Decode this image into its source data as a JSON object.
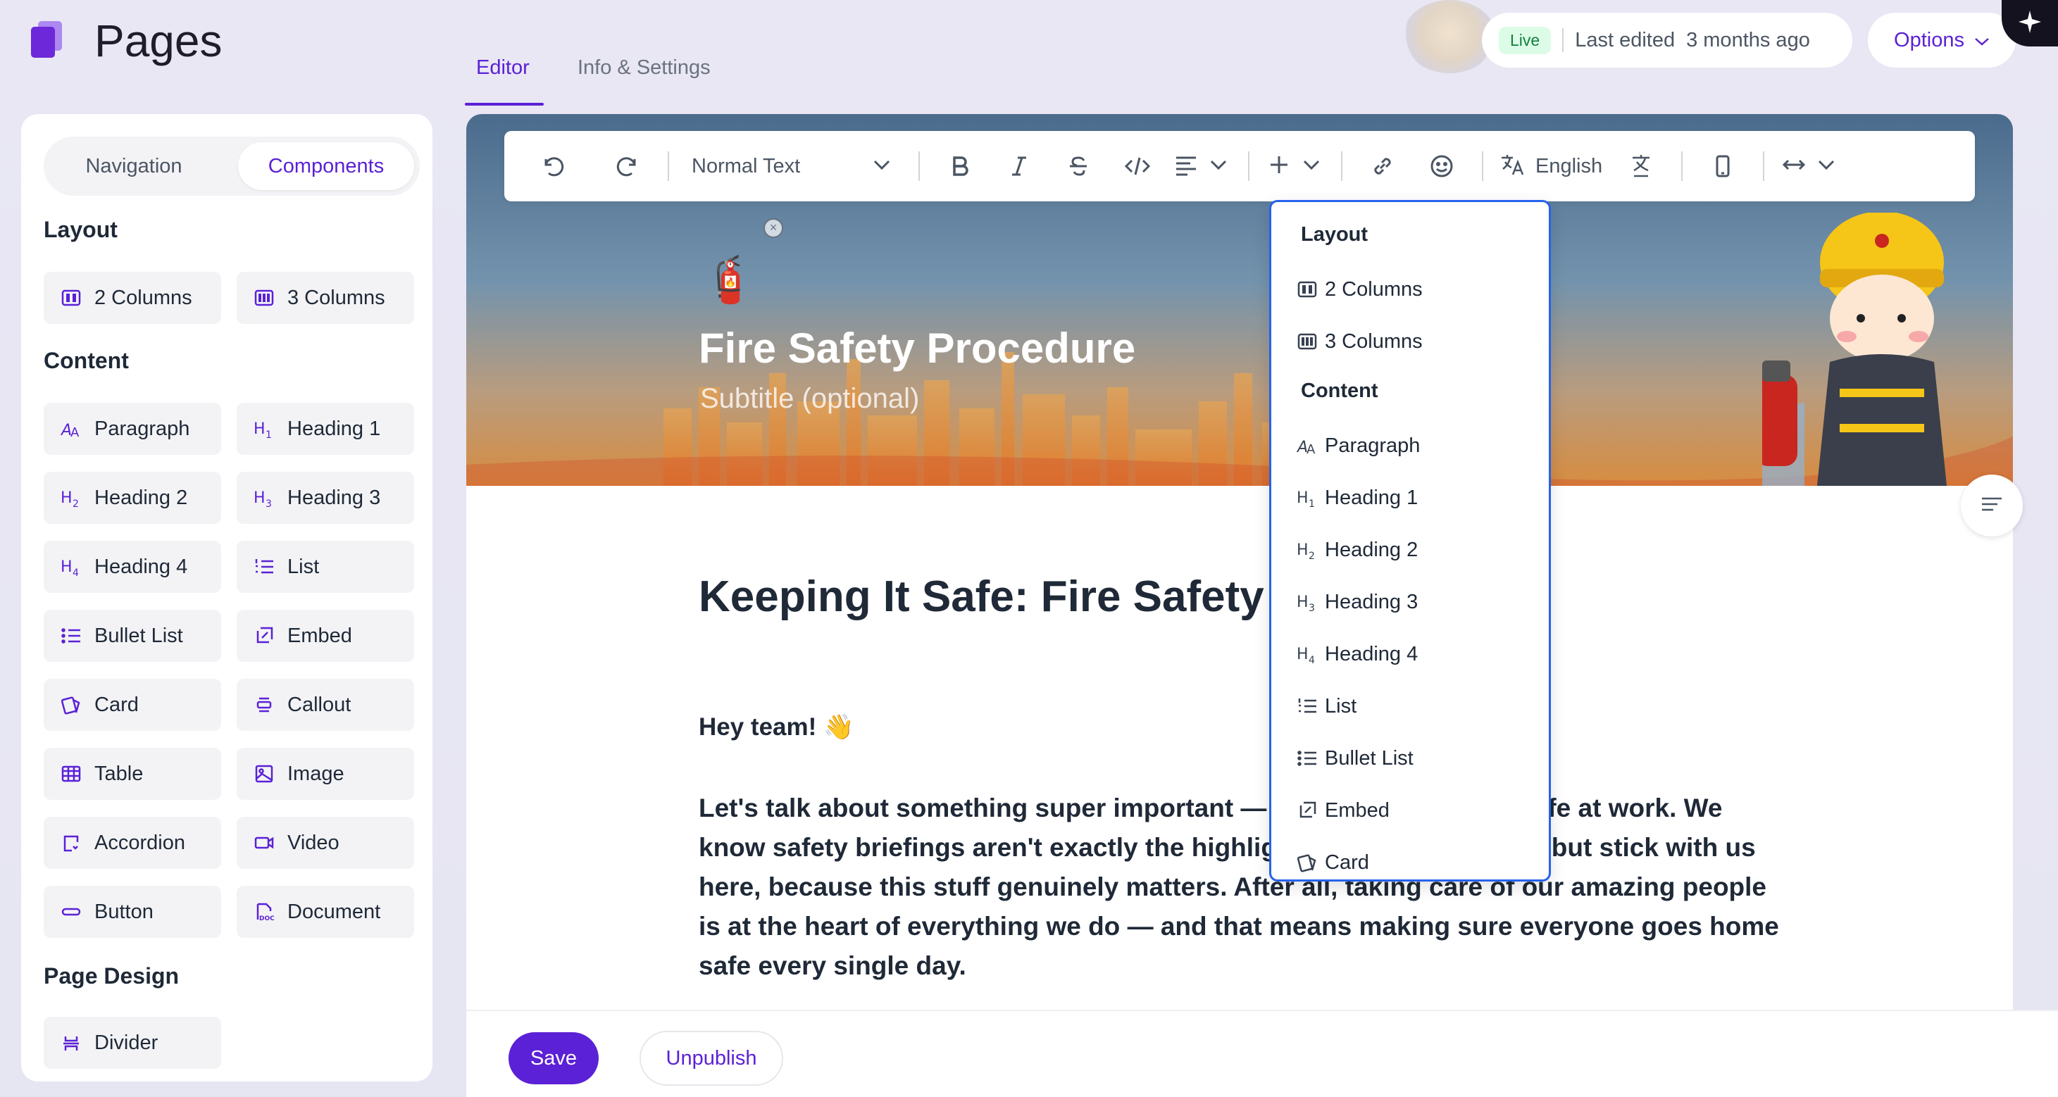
{
  "app": {
    "title": "Pages"
  },
  "tabs": [
    {
      "label": "Editor",
      "active": true
    },
    {
      "label": "Info & Settings",
      "active": false
    }
  ],
  "status": {
    "live_badge": "Live",
    "last_edited_label": "Last edited",
    "last_edited_value": "3 months ago"
  },
  "options_label": "Options",
  "sidebar": {
    "tabs": [
      "Navigation",
      "Components"
    ],
    "active_tab": "Components",
    "sections": [
      {
        "title": "Layout",
        "items": [
          {
            "label": "2 Columns",
            "icon": "two-columns-icon"
          },
          {
            "label": "3 Columns",
            "icon": "three-columns-icon"
          }
        ]
      },
      {
        "title": "Content",
        "items": [
          {
            "label": "Paragraph",
            "icon": "paragraph-icon"
          },
          {
            "label": "Heading 1",
            "icon": "heading-1-icon"
          },
          {
            "label": "Heading 2",
            "icon": "heading-2-icon"
          },
          {
            "label": "Heading 3",
            "icon": "heading-3-icon"
          },
          {
            "label": "Heading 4",
            "icon": "heading-4-icon"
          },
          {
            "label": "List",
            "icon": "numbered-list-icon"
          },
          {
            "label": "Bullet List",
            "icon": "bullet-list-icon"
          },
          {
            "label": "Embed",
            "icon": "embed-icon"
          },
          {
            "label": "Card",
            "icon": "card-icon"
          },
          {
            "label": "Callout",
            "icon": "callout-icon"
          },
          {
            "label": "Table",
            "icon": "table-icon"
          },
          {
            "label": "Image",
            "icon": "image-icon"
          },
          {
            "label": "Accordion",
            "icon": "accordion-icon"
          },
          {
            "label": "Video",
            "icon": "video-icon"
          },
          {
            "label": "Button",
            "icon": "button-icon"
          },
          {
            "label": "Document",
            "icon": "document-icon"
          }
        ]
      },
      {
        "title": "Page Design",
        "items": [
          {
            "label": "Divider",
            "icon": "divider-icon"
          }
        ]
      }
    ]
  },
  "toolbar": {
    "text_style": "Normal Text",
    "language": "English",
    "icons": [
      "undo-icon",
      "redo-icon",
      "bold-icon",
      "italic-icon",
      "strikethrough-icon",
      "code-icon",
      "align-icon",
      "insert-plus-icon",
      "link-icon",
      "emoji-icon",
      "translate-icon",
      "clear-translate-icon",
      "mobile-preview-icon",
      "width-icon"
    ]
  },
  "dropdown": {
    "sections": [
      {
        "title": "Layout",
        "items": [
          {
            "label": "2 Columns",
            "icon": "two-columns-icon"
          },
          {
            "label": "3 Columns",
            "icon": "three-columns-icon"
          }
        ]
      },
      {
        "title": "Content",
        "items": [
          {
            "label": "Paragraph",
            "icon": "paragraph-icon"
          },
          {
            "label": "Heading 1",
            "icon": "heading-1-icon"
          },
          {
            "label": "Heading 2",
            "icon": "heading-2-icon"
          },
          {
            "label": "Heading 3",
            "icon": "heading-3-icon"
          },
          {
            "label": "Heading 4",
            "icon": "heading-4-icon"
          },
          {
            "label": "List",
            "icon": "numbered-list-icon"
          },
          {
            "label": "Bullet List",
            "icon": "bullet-list-icon"
          },
          {
            "label": "Embed",
            "icon": "embed-icon"
          },
          {
            "label": "Card",
            "icon": "card-icon"
          }
        ]
      }
    ]
  },
  "hero": {
    "emoji": "🧯",
    "title": "Fire Safety Procedure",
    "subtitle": "Subtitle (optional)"
  },
  "document": {
    "heading": "Keeping It Safe: Fire Safety &",
    "greeting": "Hey team! 👋",
    "paragraph": "Let's talk about something super important — keeping each other safe at work. We know safety briefings aren't exactly the highlight of the working day, but stick with us here, because this stuff genuinely matters. After all, taking care of our amazing people is at the heart of everything we do — and that means making sure everyone goes home safe every single day."
  },
  "footer": {
    "save_label": "Save",
    "unpublish_label": "Unpublish"
  },
  "colors": {
    "accent": "#5b21d6",
    "live_bg": "#dcfce7",
    "live_text": "#15803d",
    "dropdown_border": "#2563eb"
  }
}
